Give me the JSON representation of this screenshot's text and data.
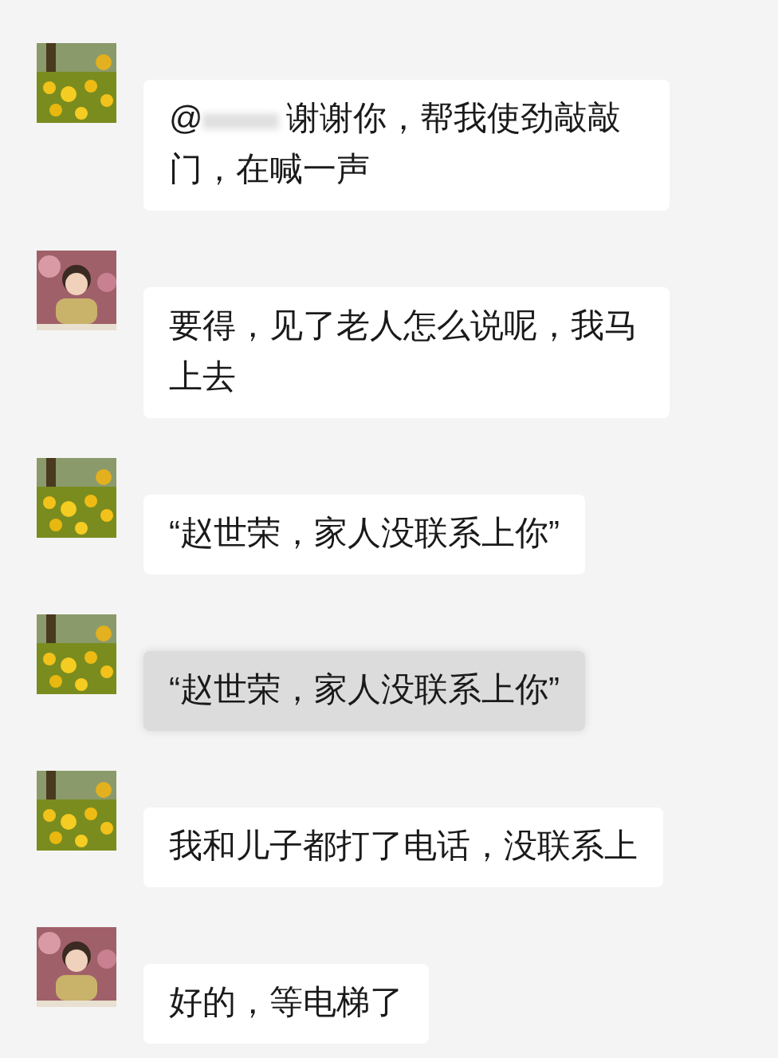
{
  "messages": [
    {
      "kind": "flowers",
      "mention": "@",
      "text": "谢谢你，帮我使劲敲敲门，在喊一声",
      "highlighted": false
    },
    {
      "kind": "person",
      "text": "要得，见了老人怎么说呢，我马上去",
      "highlighted": false
    },
    {
      "kind": "flowers",
      "text": "“赵世荣，家人没联系上你”",
      "highlighted": false
    },
    {
      "kind": "flowers",
      "text": "“赵世荣，家人没联系上你”",
      "highlighted": true
    },
    {
      "kind": "flowers",
      "text": "我和儿子都打了电话，没联系上",
      "highlighted": false
    },
    {
      "kind": "person",
      "text": "好的，等电梯了",
      "highlighted": false
    }
  ]
}
